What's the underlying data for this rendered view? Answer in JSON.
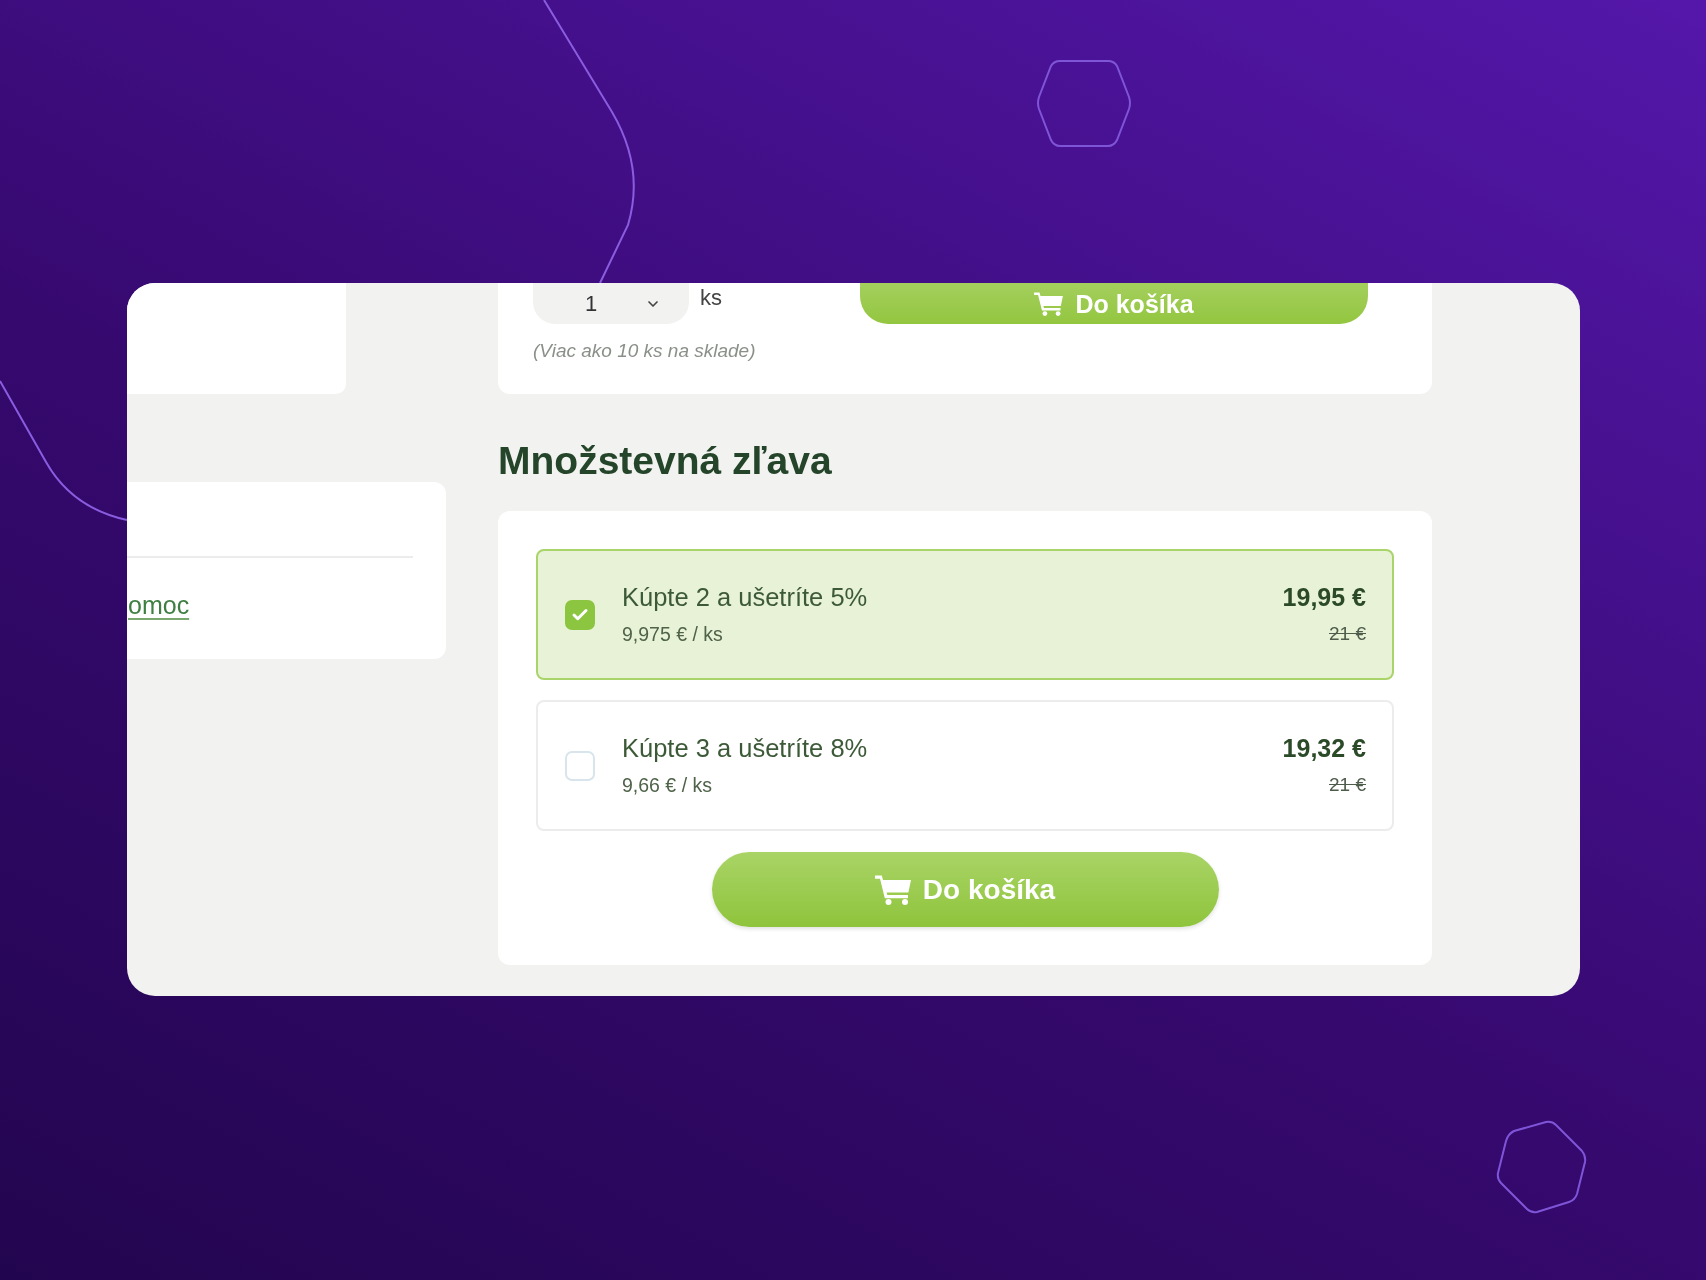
{
  "product_panel": {
    "quantity": {
      "value": "1"
    },
    "unit": "ks",
    "add_to_cart": "Do košíka",
    "stock_note": "(Viac ako 10 ks na sklade)"
  },
  "side_panel": {
    "link": "omoc"
  },
  "quantity_discount": {
    "title": "Množstevná zľava",
    "options": [
      {
        "label": "Kúpte 2 a ušetríte 5%",
        "unit_price": "9,975 € / ks",
        "price": "19,95 €",
        "old_price": "21 €",
        "selected": true
      },
      {
        "label": "Kúpte 3 a ušetríte 8%",
        "unit_price": "9,66 € / ks",
        "price": "19,32 €",
        "old_price": "21 €",
        "selected": false
      }
    ],
    "add_to_cart": "Do košíka"
  }
}
